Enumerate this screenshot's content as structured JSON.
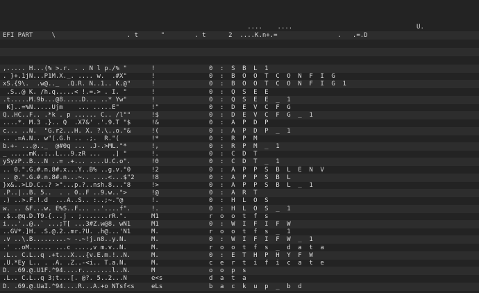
{
  "header": {
    "row1": "                                                                 ....    ....                                 U.",
    "row2": "EFI PART     \\                   . t      \"        . t      2  ....K.n+.=                .   .=.D"
  },
  "rows": [
    {
      "ascii": ",..... H...(% >.r. . . N l p./% \"",
      "mid": "!",
      "label": "0 : S B L 1"
    },
    {
      "ascii": ". }+.1jN...P1M.X._. .... w.  .#X\"",
      "mid": "!",
      "label": "0 : B O O T C O N F I G"
    },
    {
      "ascii": "xS.{9\\.  .w@.._  .Q.R. N..1.. K.@\"",
      "mid": "!",
      "label": "0 : B O O T C O N F I G 1"
    },
    {
      "ascii": " .S..@ K. /h.q.....< !.=.> . I. \"",
      "mid": "!",
      "label": "0 : Q S E E"
    },
    {
      "ascii": ".t.....M.9b...@8.....D... ..* Yw\"",
      "mid": "!",
      "label": "0 : Q S E E _ 1"
    },
    {
      "ascii": " K]..=%N.....Ujm    ... .....E\"",
      "mid": "!\"",
      "label": "0 : D E V C F G"
    },
    {
      "ascii": "Q..HC..F.. .*k . p ...... C.. /l\"\"",
      "mid": "!$",
      "label": "0 : D E V C F G _ 1"
    },
    {
      "ascii": "....*. M.3 .}.. Q  .X7&' .'.9.T \"$",
      "mid": "!&",
      "label": "0 : A P D P"
    },
    {
      "ascii": "c... ..N.  \"G.r2...H. X. ?.\\..o.\"&",
      "mid": "!(",
      "label": "0 : A P D P _ 1"
    },
    {
      "ascii": ".. .=A.N.. w\"(.G.h .. .;.  R.\"(",
      "mid": "!*",
      "label": "0 : R P M"
    },
    {
      "ascii": "b.+- ...@.._  @#0q ... .J-.>ML.\"*",
      "mid": "!,",
      "label": "0 : R P M _ 1"
    },
    {
      "ascii": "_ .....mK..:..L...9.zR ...   .] \"",
      "mid": "!.",
      "label": "0 : C D T"
    },
    {
      "ascii": "ySyzP..B...N ..= .+... ....U.C.o\".",
      "mid": "!0",
      "label": "0 : C D T _ 1"
    },
    {
      "ascii": ".. 0.\".G.#.n.8#.x...Y..B% ..g.v.\"0",
      "mid": "!2",
      "label": "0 : A P P S B L E N V"
    },
    {
      "ascii": ".. @.\".G.#.n.8#.n...~.. ....<...$\"2",
      "mid": "!8",
      "label": "0 : A P P S B L"
    },
    {
      "ascii": "}x&..>LD.C..? >\"...p.?..nsh.8...\"8",
      "mid": "!>",
      "label": "0 : A P P S B L _ 1"
    },
    {
      "ascii": ".P..|..B. 5..  . . 0..F ..9.w..\">",
      "mid": "!@",
      "label": "0 : A R T"
    },
    {
      "ascii": ".) ..>.F.!.d  ...A..S.. :..;~.\"@",
      "mid": "!.",
      "label": "0 : H L O S"
    },
    {
      "ascii": "w. .. &F...w. E%S..F... ..'....f\".",
      "mid": "!.",
      "label": "0 : H L O S _ 1"
    },
    {
      "ascii": ".$..@q.D.T9.{...j . ;.......rR.\".",
      "mid": "M1",
      "label": "r o o t f s"
    },
    {
      "ascii": "i...'..@..` ...;T[ ...3#Z.w@8. wN1",
      "mid": "M1",
      "label": "0 : W I F I F W"
    },
    {
      "ascii": "..GV*.]H. .S.@.2..mr.?U. .h@...'N1",
      "mid": "M.",
      "label": "r o o t f s _ 1"
    },
    {
      "ascii": ".v ..\\.B.........~ -.~!j.n8..y.N.",
      "mid": "M.",
      "label": "0 : W I F I F W _ 1"
    },
    {
      "ascii": ".' ..oM...... ...c ....,v m.v..N.",
      "mid": "M.",
      "label": "r o o t f s _ d a t a"
    },
    {
      "ascii": ".L.. C.L..q .+t...X...{v.E.m.!..N.",
      "mid": "M.",
      "label": "0 : E T H P H Y F W"
    },
    {
      "ascii": ".U.*Ey L.. . .A. .Z..-<i.. T.a.N.",
      "mid": "M.",
      "label": "c e r t i f i c a t e"
    },
    {
      "ascii": "D. .69.@.U1F.^94....r........l..N.",
      "mid": "M",
      "label": "o o p s"
    },
    {
      "ascii": ".L.. C.L..q 3;t...[. @?. 5..2...N",
      "mid": "e<s",
      "label": "d a t a"
    },
    {
      "ascii": "D. .69.@.UaI.^94....R...A.+o NTsf<s",
      "mid": "eLs",
      "label": "b a c k u p _ b d"
    }
  ]
}
